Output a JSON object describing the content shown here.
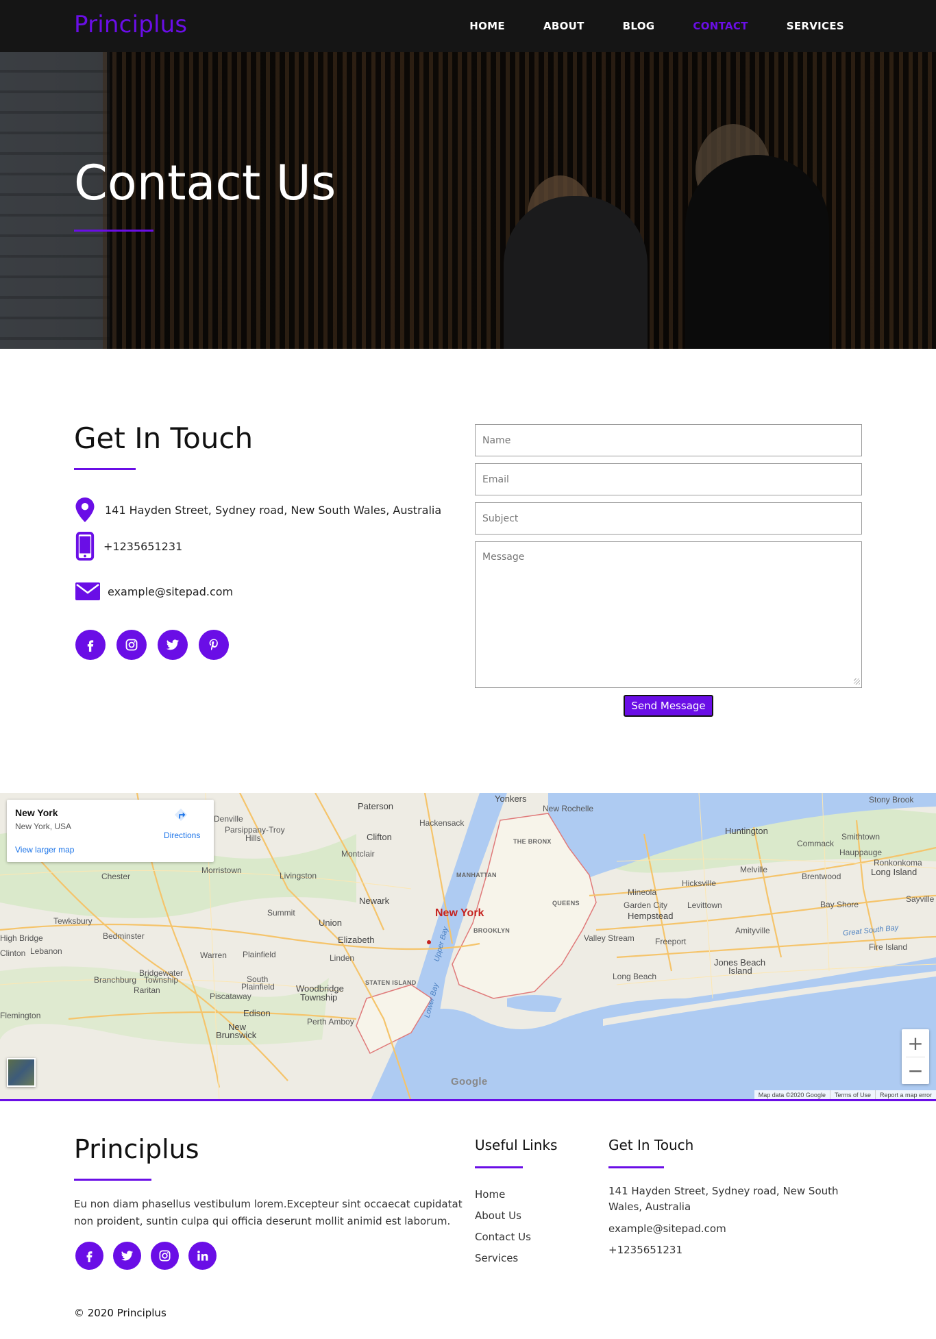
{
  "brand": {
    "name": "Principlus",
    "accent": "#6a0ee6"
  },
  "nav": {
    "items": [
      "HOME",
      "ABOUT",
      "BLOG",
      "CONTACT",
      "SERVICES"
    ],
    "active": "CONTACT"
  },
  "hero": {
    "title": "Contact Us"
  },
  "contact": {
    "title": "Get In Touch",
    "address": "141 Hayden Street, Sydney road, New South Wales, Australia",
    "phone": "+1235651231",
    "email": "example@sitepad.com",
    "social_icons": [
      "facebook-icon",
      "instagram-icon",
      "twitter-icon",
      "pinterest-icon"
    ]
  },
  "form": {
    "name_placeholder": "Name",
    "email_placeholder": "Email",
    "subject_placeholder": "Subject",
    "message_placeholder": "Message",
    "submit_label": "Send Message"
  },
  "map": {
    "place_title": "New York",
    "place_subtitle": "New York, USA",
    "larger_map": "View larger map",
    "directions": "Directions",
    "zoom_in": "+",
    "zoom_out": "−",
    "google": "Google",
    "attribution": [
      "Map data ©2020 Google",
      "Terms of Use",
      "Report a map error"
    ],
    "places": {
      "yonkers": "Yonkers",
      "new_rochelle": "New Rochelle",
      "paterson": "Paterson",
      "hackensack": "Hackensack",
      "clifton": "Clifton",
      "montclair": "Montclair",
      "parsippany": "Parsippany-Troy",
      "hills": "Hills",
      "denville": "Denville",
      "morristown": "Morristown",
      "livingston": "Livingston",
      "chester": "Chester",
      "newark": "Newark",
      "summit": "Summit",
      "union": "Union",
      "elizabeth": "Elizabeth",
      "new_york": "New York",
      "manhattan": "MANHATTAN",
      "bronx": "THE BRONX",
      "queens": "QUEENS",
      "brooklyn": "BROOKLYN",
      "staten_island": "STATEN ISLAND",
      "bedminster": "Bedminster",
      "tewksbury": "Tewksbury",
      "lebanon": "Lebanon",
      "high_bridge": "High Bridge",
      "clinton": "Clinton",
      "warren": "Warren",
      "plainfield": "Plainfield",
      "linden": "Linden",
      "bridgewater": "Bridgewater",
      "township": "Township",
      "branchburg": "Branchburg",
      "raritan": "Raritan",
      "south": "South",
      "south_plainfield": "Plainfield",
      "piscataway": "Piscataway",
      "woodbridge": "Woodbridge",
      "woodbridge_tw": "Township",
      "edison": "Edison",
      "perth_amboy": "Perth Amboy",
      "new": "New",
      "brunswick": "Brunswick",
      "flemington": "Flemington",
      "huntington": "Huntington",
      "commack": "Commack",
      "smithtown": "Smithtown",
      "stony_brook": "Stony Brook",
      "hauppauge": "Hauppauge",
      "ronkonkoma": "Ronkonkoma",
      "long_island": "Long Island",
      "melville": "Melville",
      "brentwood": "Brentwood",
      "hicksville": "Hicksville",
      "mineola": "Mineola",
      "garden_city": "Garden City",
      "hempstead": "Hempstead",
      "levittown": "Levittown",
      "bay_shore": "Bay Shore",
      "sayville": "Sayville",
      "amityville": "Amityville",
      "freeport": "Freeport",
      "valley_stream": "Valley Stream",
      "long_beach": "Long Beach",
      "jones_beach": "Jones Beach",
      "island": "Island",
      "fire_island": "Fire Island",
      "great_south_bay": "Great South Bay",
      "upper_bay": "Upper Bay",
      "lower_bay": "Lower Bay"
    }
  },
  "footer": {
    "brand": "Principlus",
    "about": "Eu non diam phasellus vestibulum lorem.Excepteur sint occaecat cupidatat non proident, suntin culpa qui officia deserunt mollit animid est laborum.",
    "social_icons": [
      "facebook-icon",
      "twitter-icon",
      "instagram-icon",
      "linkedin-icon"
    ],
    "links_title": "Useful Links",
    "links": [
      "Home",
      "About Us",
      "Contact Us",
      "Services"
    ],
    "touch_title": "Get In Touch",
    "address": "141 Hayden Street, Sydney road, New South Wales, Australia",
    "email": "example@sitepad.com",
    "phone": "+1235651231",
    "copyright": "© 2020 Principlus"
  }
}
